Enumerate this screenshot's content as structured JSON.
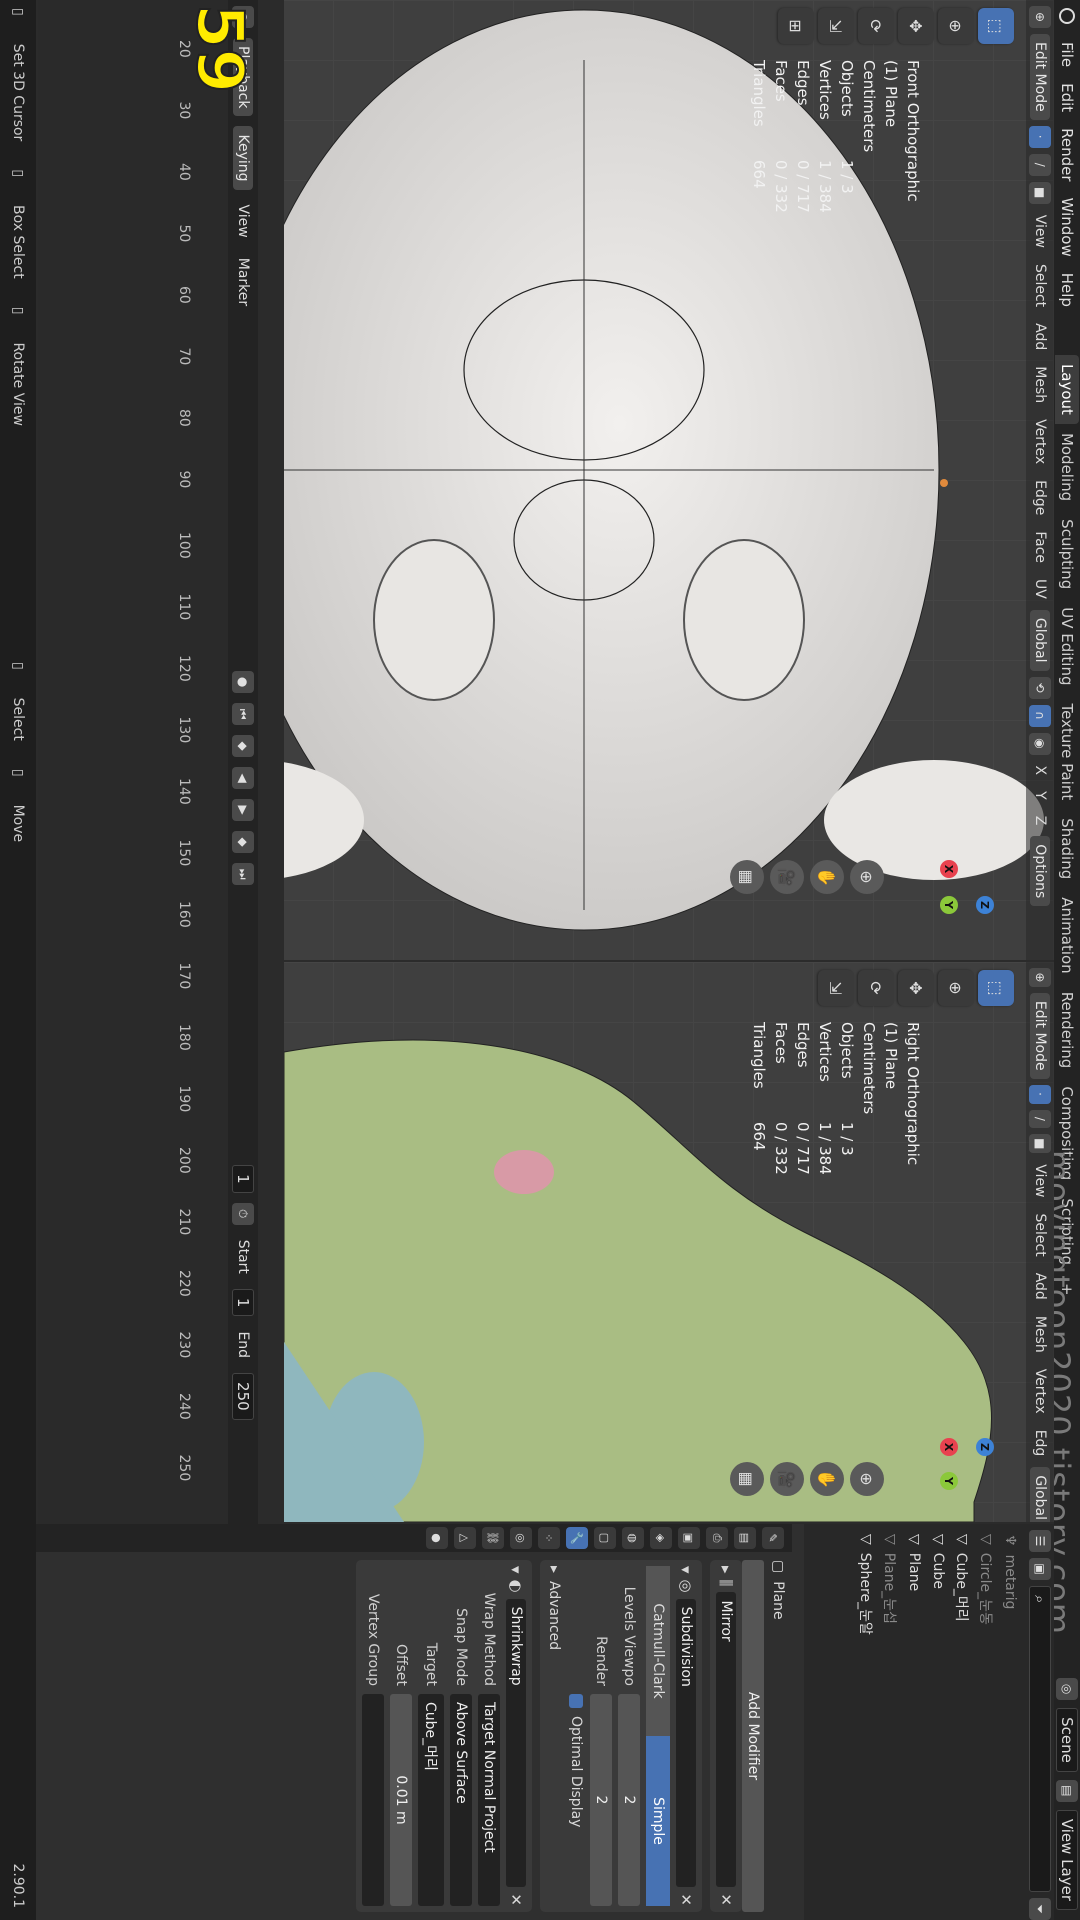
{
  "menu": [
    "File",
    "Edit",
    "Render",
    "Window",
    "Help"
  ],
  "workspaces": [
    "Layout",
    "Modeling",
    "Sculpting",
    "UV Editing",
    "Texture Paint",
    "Shading",
    "Animation",
    "Rendering",
    "Compositing",
    "Scripting"
  ],
  "active_workspace": "Layout",
  "scene": "Scene",
  "view_layer": "View Layer",
  "watermark": "movingtoon2020.tistory.com",
  "viewport_left": {
    "mode": "Edit Mode",
    "menus": [
      "View",
      "Select",
      "Add",
      "Mesh",
      "Vertex",
      "Edge",
      "Face",
      "UV"
    ],
    "transform_orientation": "Global",
    "axes": [
      "X",
      "Y",
      "Z"
    ],
    "options": "Options",
    "info_title": "Front Orthographic",
    "info_object": "(1) Plane",
    "info_units": "Centimeters",
    "stats": [
      {
        "k": "Objects",
        "v": "1 / 3"
      },
      {
        "k": "Vertices",
        "v": "1 / 384"
      },
      {
        "k": "Edges",
        "v": "0 / 717"
      },
      {
        "k": "Faces",
        "v": "0 / 332"
      },
      {
        "k": "Triangles",
        "v": "664"
      }
    ]
  },
  "viewport_right": {
    "mode": "Edit Mode",
    "menus": [
      "View",
      "Select",
      "Add",
      "Mesh",
      "Vertex",
      "Edg"
    ],
    "transform_orientation": "Global",
    "info_title": "Right Orthographic",
    "info_object": "(1) Plane",
    "info_units": "Centimeters",
    "stats": [
      {
        "k": "Objects",
        "v": "1 / 3"
      },
      {
        "k": "Vertices",
        "v": "1 / 384"
      },
      {
        "k": "Edges",
        "v": "0 / 717"
      },
      {
        "k": "Faces",
        "v": "0 / 332"
      },
      {
        "k": "Triangles",
        "v": "664"
      }
    ]
  },
  "outliner": [
    {
      "name": "metarig",
      "dim": true
    },
    {
      "name": "Circle_눈동",
      "dim": true
    },
    {
      "name": "Cube_머리",
      "dim": false
    },
    {
      "name": "Cube",
      "dim": false
    },
    {
      "name": "Plane",
      "dim": false
    },
    {
      "name": "Plane_눈섭",
      "dim": true
    },
    {
      "name": "Sphere_눈알",
      "dim": false
    }
  ],
  "properties": {
    "object": "Plane",
    "add_modifier": "Add Modifier",
    "mirror": "Mirror",
    "subdivision": "Subdivision",
    "subdiv_types": [
      "Catmull-Clark",
      "Simple"
    ],
    "subdiv_active": "Simple",
    "levels_viewport_label": "Levels Viewpo",
    "levels_viewport": "2",
    "render_label": "Render",
    "render": "2",
    "optimal_display": "Optimal Display",
    "advanced": "Advanced",
    "shrinkwrap": "Shrinkwrap",
    "wrap_method_label": "Wrap Method",
    "wrap_method": "Target Normal Project",
    "snap_mode_label": "Snap Mode",
    "snap_mode": "Above Surface",
    "target_label": "Target",
    "target": "Cube_머리",
    "offset_label": "Offset",
    "offset": "0.01 m",
    "vertex_group_label": "Vertex Group"
  },
  "timeline": {
    "menus": [
      "Playback",
      "Keying",
      "View",
      "Marker"
    ],
    "current_frame": "1",
    "start_label": "Start",
    "start": "1",
    "end_label": "End",
    "end": "250",
    "ticks": [
      "20",
      "30",
      "40",
      "50",
      "60",
      "70",
      "80",
      "90",
      "100",
      "110",
      "120",
      "130",
      "140",
      "150",
      "160",
      "170",
      "180",
      "190",
      "200",
      "210",
      "220",
      "230",
      "240",
      "250"
    ]
  },
  "statusbar": {
    "set_cursor": "Set 3D Cursor",
    "box_select": "Box Select",
    "rotate_view": "Rotate View",
    "select": "Select",
    "move": "Move",
    "version": "2.90.1"
  },
  "frame_badge": "59",
  "colors": {
    "accent": "#4772b3",
    "x_axis": "#e8424f",
    "y_axis": "#8bc83a",
    "z_axis": "#3d82d6",
    "face_shade": "#a9bd83"
  }
}
